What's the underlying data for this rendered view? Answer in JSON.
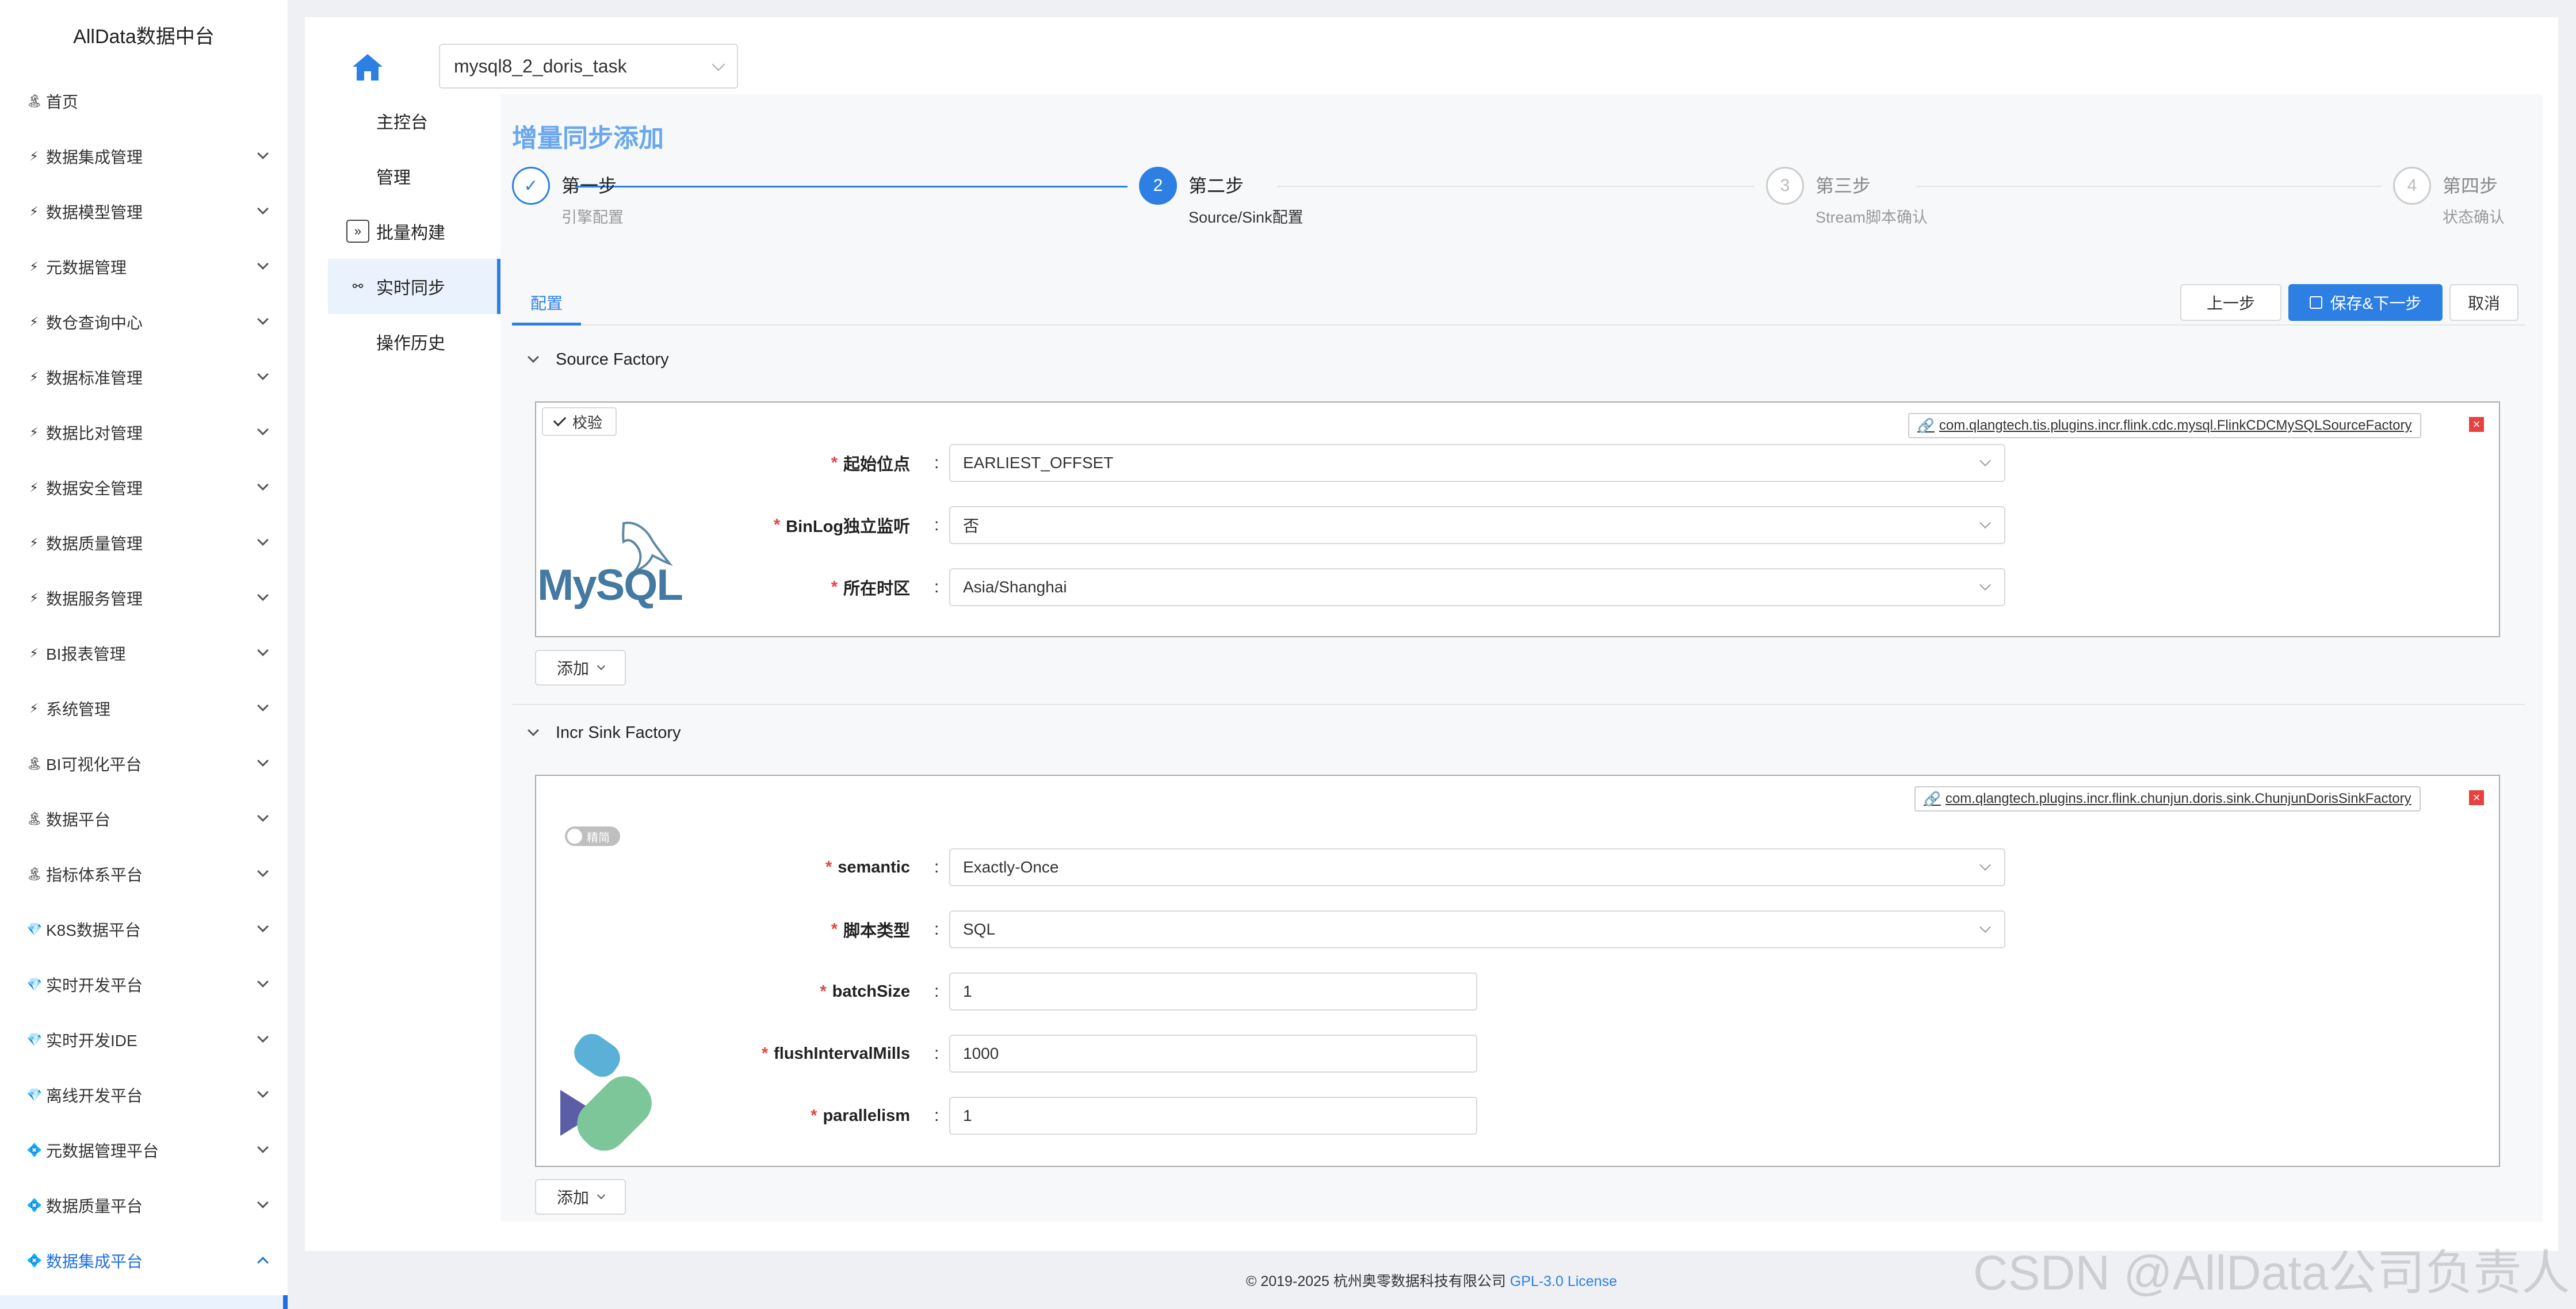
{
  "app": {
    "brand": "AllData数据中台"
  },
  "sidebar": {
    "items": [
      {
        "icon": "🏝",
        "label": "首页",
        "has_children": false
      },
      {
        "icon": "⚡",
        "label": "数据集成管理",
        "has_children": true
      },
      {
        "icon": "⚡",
        "label": "数据模型管理",
        "has_children": true
      },
      {
        "icon": "⚡",
        "label": "元数据管理",
        "has_children": true
      },
      {
        "icon": "⚡",
        "label": "数仓查询中心",
        "has_children": true
      },
      {
        "icon": "⚡",
        "label": "数据标准管理",
        "has_children": true
      },
      {
        "icon": "⚡",
        "label": "数据比对管理",
        "has_children": true
      },
      {
        "icon": "⚡",
        "label": "数据安全管理",
        "has_children": true
      },
      {
        "icon": "⚡",
        "label": "数据质量管理",
        "has_children": true
      },
      {
        "icon": "⚡",
        "label": "数据服务管理",
        "has_children": true
      },
      {
        "icon": "⚡",
        "label": "BI报表管理",
        "has_children": true
      },
      {
        "icon": "⚡",
        "label": "系统管理",
        "has_children": true
      },
      {
        "icon": "🏝",
        "label": "BI可视化平台",
        "has_children": true
      },
      {
        "icon": "🏝",
        "label": "数据平台",
        "has_children": true
      },
      {
        "icon": "🏝",
        "label": "指标体系平台",
        "has_children": true
      },
      {
        "icon": "💎",
        "label": "K8S数据平台",
        "has_children": true
      },
      {
        "icon": "💎",
        "label": "实时开发平台",
        "has_children": true
      },
      {
        "icon": "💎",
        "label": "实时开发IDE",
        "has_children": true
      },
      {
        "icon": "💎",
        "label": "离线开发平台",
        "has_children": true
      },
      {
        "icon": "💠",
        "label": "元数据管理平台",
        "has_children": true
      },
      {
        "icon": "💠",
        "label": "数据质量平台",
        "has_children": true
      },
      {
        "icon": "💠",
        "label": "数据集成平台",
        "has_children": true,
        "active": true
      }
    ]
  },
  "header": {
    "task_select": "mysql8_2_doris_task"
  },
  "subnav": {
    "items": [
      {
        "label": "主控台"
      },
      {
        "label": "管理"
      },
      {
        "label": "批量构建",
        "icon": "»"
      },
      {
        "label": "实时同步",
        "icon": "⚯",
        "active": true
      },
      {
        "label": "操作历史"
      }
    ]
  },
  "page": {
    "title": "增量同步添加"
  },
  "steps": [
    {
      "index": "✓",
      "title": "第一步",
      "desc": "引擎配置",
      "status": "done"
    },
    {
      "index": "2",
      "title": "第二步",
      "desc": "Source/Sink配置",
      "status": "current"
    },
    {
      "index": "3",
      "title": "第三步",
      "desc": "Stream脚本确认",
      "status": "pending"
    },
    {
      "index": "4",
      "title": "第四步",
      "desc": "状态确认",
      "status": "pending"
    }
  ],
  "tabs": {
    "config": "配置"
  },
  "actions": {
    "prev": "上一步",
    "save_next": "保存&下一步",
    "cancel": "取消"
  },
  "source": {
    "section_title": "Source Factory",
    "check_label": "校验",
    "factory_class": "com.qlangtech.tis.plugins.incr.flink.cdc.mysql.FlinkCDCMySQLSourceFactory",
    "logo_text": "MySQL",
    "fields": [
      {
        "label": "起始位点",
        "value": "EARLIEST_OFFSET",
        "type": "select"
      },
      {
        "label": "BinLog独立监听",
        "value": "否",
        "type": "select"
      },
      {
        "label": "所在时区",
        "value": "Asia/Shanghai",
        "type": "select"
      }
    ],
    "add_label": "添加"
  },
  "sink": {
    "section_title": "Incr Sink Factory",
    "toggle_label": "精简",
    "factory_class": "com.qlangtech.plugins.incr.flink.chunjun.doris.sink.ChunjunDorisSinkFactory",
    "fields": [
      {
        "label": "semantic",
        "value": "Exactly-Once",
        "type": "select"
      },
      {
        "label": "脚本类型",
        "value": "SQL",
        "type": "select"
      },
      {
        "label": "batchSize",
        "value": "1",
        "type": "text"
      },
      {
        "label": "flushIntervalMills",
        "value": "1000",
        "type": "text"
      },
      {
        "label": "parallelism",
        "value": "1",
        "type": "text"
      }
    ],
    "add_label": "添加"
  },
  "footer": {
    "copyright": "© 2019-2025 杭州奥零数据科技有限公司 ",
    "license": "GPL-3.0 License"
  },
  "watermark": "CSDN @AllData公司负责人",
  "colors": {
    "accent": "#2d7fe3",
    "title": "#6aa7ee",
    "required": "#e64340"
  }
}
